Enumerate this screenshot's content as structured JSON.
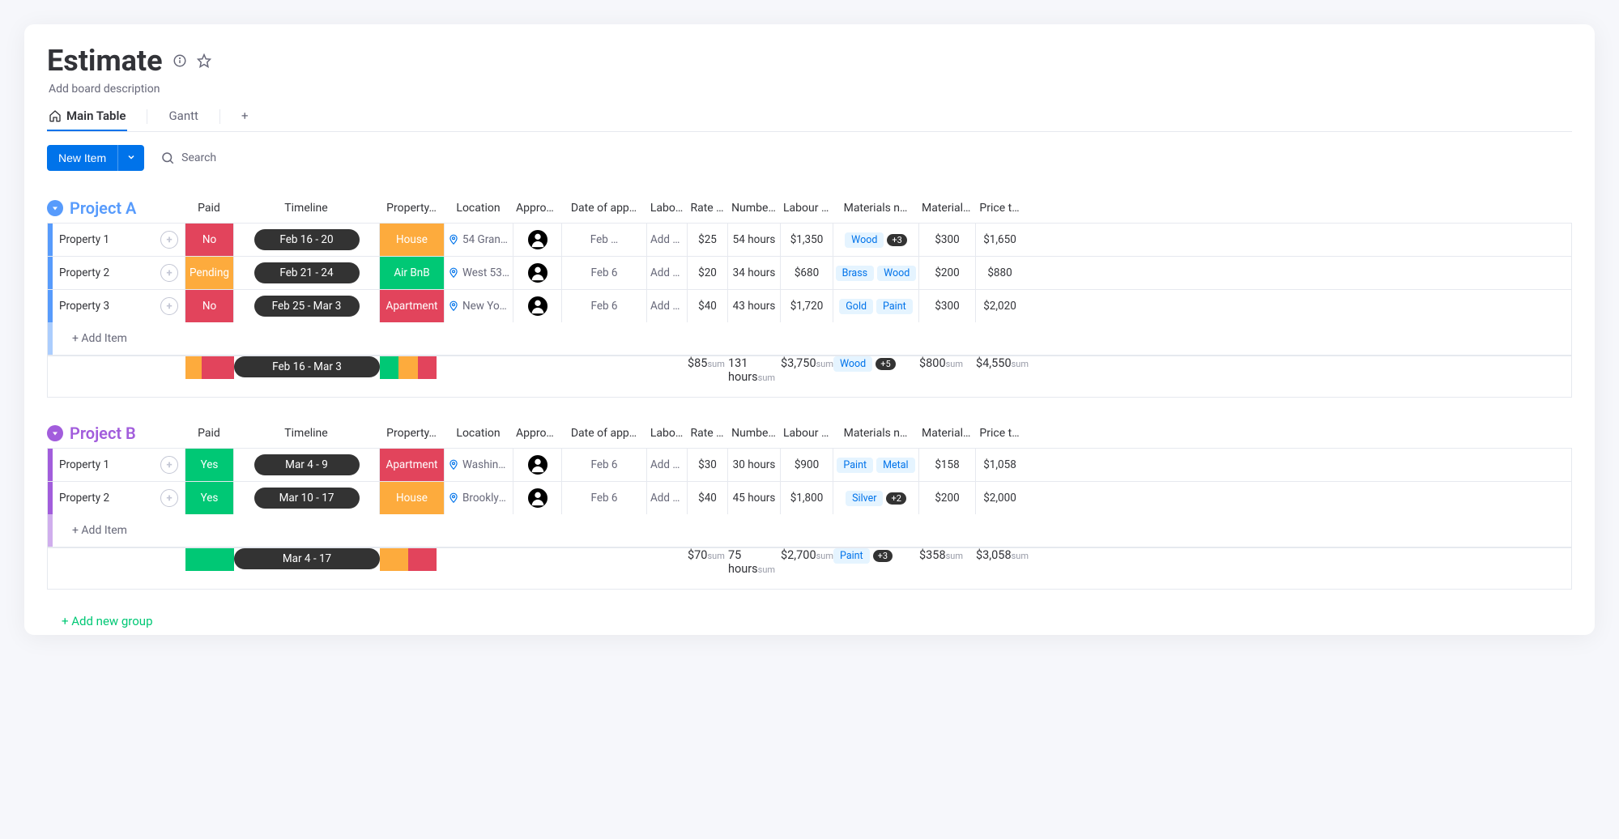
{
  "header": {
    "title": "Estimate",
    "description": "Add board description"
  },
  "tabs": [
    {
      "label": "Main Table",
      "active": true
    },
    {
      "label": "Gantt",
      "active": false
    }
  ],
  "toolbar": {
    "new_item": "New Item",
    "search": "Search"
  },
  "columns": [
    "Paid",
    "Timeline",
    "Property…",
    "Location",
    "Approver",
    "Date of app…",
    "Labo…",
    "Rate …",
    "Numbe…",
    "Labour c…",
    "Materials n…",
    "Material …",
    "Price t…"
  ],
  "groups": [
    {
      "title": "Project A",
      "color": "#579bfc",
      "rows": [
        {
          "name": "Property 1",
          "paid": {
            "label": "No",
            "color": "red"
          },
          "timeline": "Feb 16 - 20",
          "property": {
            "label": "House",
            "color": "orange"
          },
          "location": "54 Grand…",
          "date": "Feb …",
          "labour_desc": "Add d…",
          "rate": "$25",
          "hours": "54 hours",
          "labour_cost": "$1,350",
          "materials": [
            "Wood"
          ],
          "materials_extra": "+3",
          "material_cost": "$300",
          "price": "$1,650"
        },
        {
          "name": "Property 2",
          "paid": {
            "label": "Pending",
            "color": "orange"
          },
          "timeline": "Feb 21 - 24",
          "property": {
            "label": "Air BnB",
            "color": "green"
          },
          "location": "West 53r…",
          "date": "Feb 6",
          "labour_desc": "Add d…",
          "rate": "$20",
          "hours": "34 hours",
          "labour_cost": "$680",
          "materials": [
            "Brass",
            "Wood"
          ],
          "materials_extra": "",
          "material_cost": "$200",
          "price": "$880"
        },
        {
          "name": "Property 3",
          "paid": {
            "label": "No",
            "color": "red"
          },
          "timeline": "Feb 25 - Mar 3",
          "property": {
            "label": "Apartment",
            "color": "red"
          },
          "location": "New Yor…",
          "date": "Feb 6",
          "labour_desc": "Add d…",
          "rate": "$40",
          "hours": "43 hours",
          "labour_cost": "$1,720",
          "materials": [
            "Gold",
            "Paint"
          ],
          "materials_extra": "",
          "material_cost": "$300",
          "price": "$2,020"
        }
      ],
      "add_item": "+ Add Item",
      "summary": {
        "timeline": "Feb 16 - Mar 3",
        "paid_bar": [
          "o",
          "r",
          "r"
        ],
        "prop_bar": [
          "g",
          "o",
          "r"
        ],
        "rate": "$85",
        "hours": "131 hours",
        "labour_cost": "$3,750",
        "materials": [
          "Wood"
        ],
        "materials_extra": "+5",
        "material_cost": "$800",
        "price": "$4,550",
        "sum_label": "sum"
      }
    },
    {
      "title": "Project B",
      "color": "#a25ddc",
      "rows": [
        {
          "name": "Property 1",
          "paid": {
            "label": "Yes",
            "color": "green"
          },
          "timeline": "Mar 4 - 9",
          "property": {
            "label": "Apartment",
            "color": "red"
          },
          "location": "Washingt…",
          "date": "Feb 6",
          "labour_desc": "Add d…",
          "rate": "$30",
          "hours": "30 hours",
          "labour_cost": "$900",
          "materials": [
            "Paint",
            "Metal"
          ],
          "materials_extra": "",
          "material_cost": "$158",
          "price": "$1,058"
        },
        {
          "name": "Property 2",
          "paid": {
            "label": "Yes",
            "color": "green"
          },
          "timeline": "Mar 10 - 17",
          "property": {
            "label": "House",
            "color": "orange"
          },
          "location": "Brooklyn,…",
          "date": "Feb 6",
          "labour_desc": "Add d…",
          "rate": "$40",
          "hours": "45 hours",
          "labour_cost": "$1,800",
          "materials": [
            "Silver"
          ],
          "materials_extra": "+2",
          "material_cost": "$200",
          "price": "$2,000"
        }
      ],
      "add_item": "+ Add Item",
      "summary": {
        "timeline": "Mar 4 - 17",
        "paid_bar": [
          "g",
          "g"
        ],
        "prop_bar": [
          "o",
          "r"
        ],
        "rate": "$70",
        "hours": "75 hours",
        "labour_cost": "$2,700",
        "materials": [
          "Paint"
        ],
        "materials_extra": "+3",
        "material_cost": "$358",
        "price": "$3,058",
        "sum_label": "sum"
      }
    }
  ],
  "add_group": "+ Add new group"
}
